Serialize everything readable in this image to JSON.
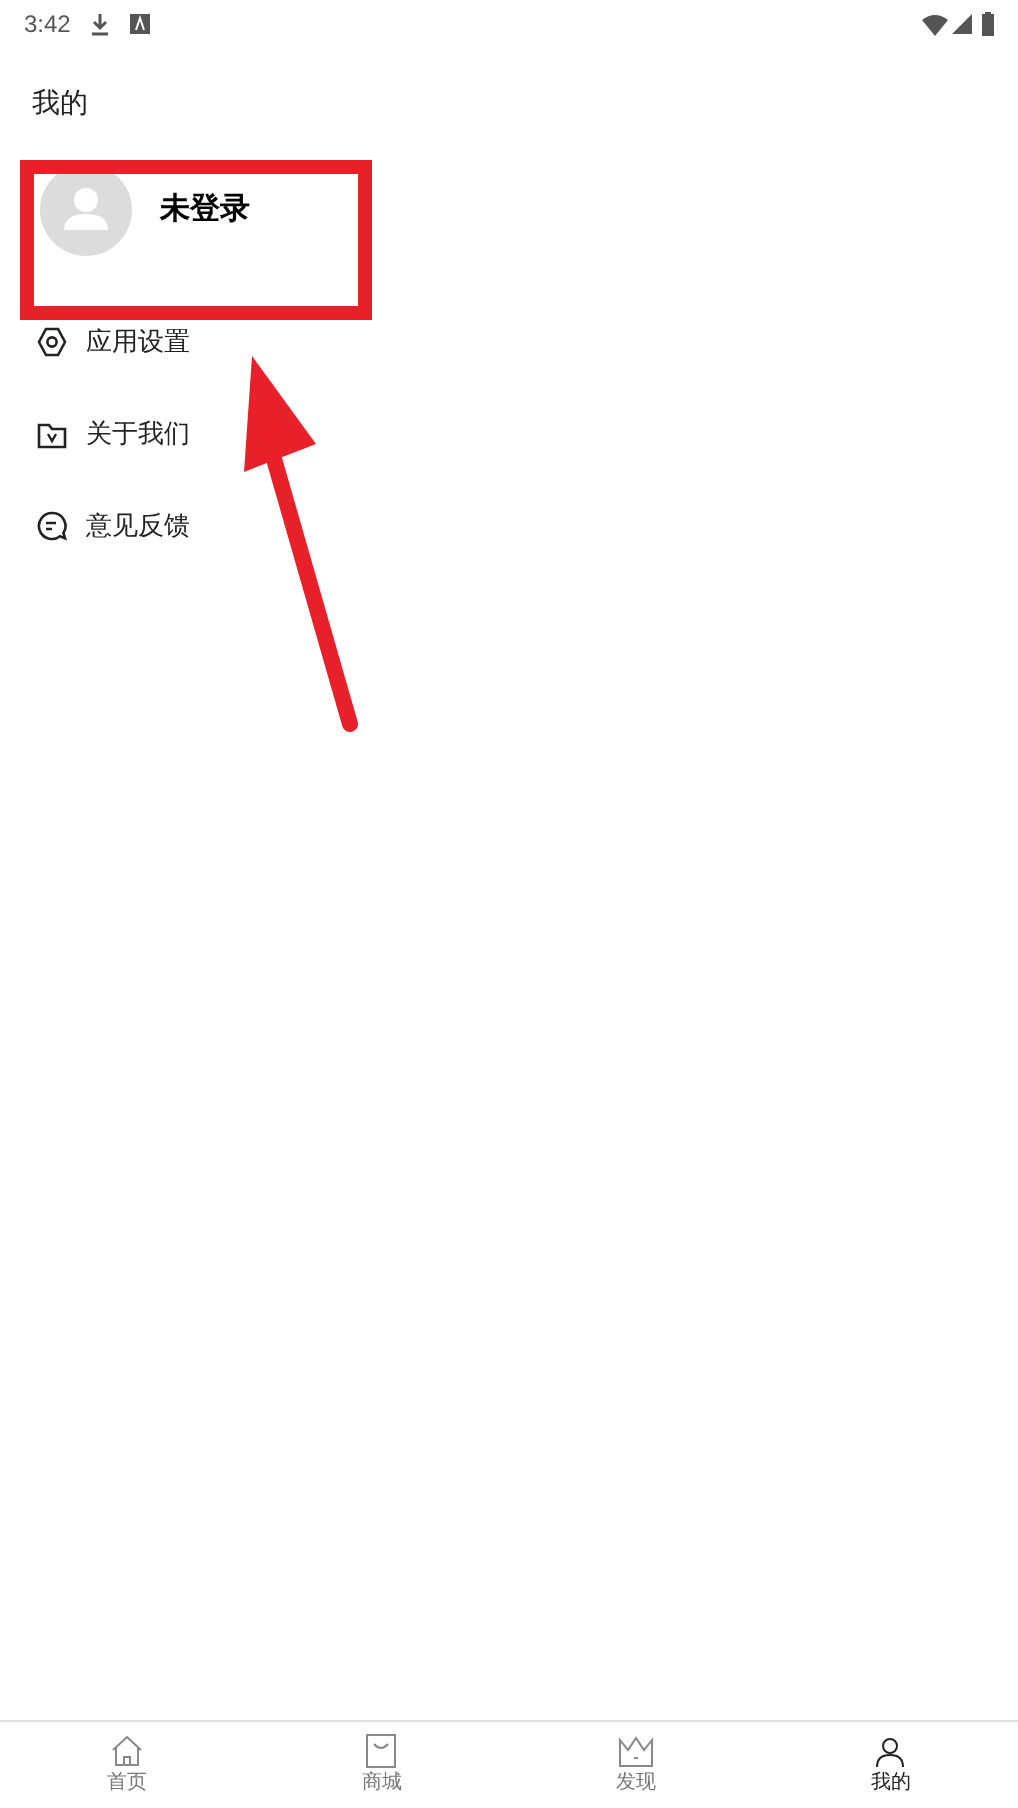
{
  "status_bar": {
    "time": "3:42"
  },
  "page_title": "我的",
  "profile": {
    "name": "未登录"
  },
  "menu": [
    {
      "kind": "settings",
      "label": "应用设置"
    },
    {
      "kind": "about",
      "label": "关于我们"
    },
    {
      "kind": "feedback",
      "label": "意见反馈"
    }
  ],
  "tab_bar": [
    {
      "kind": "home",
      "label": "首页",
      "selected": false
    },
    {
      "kind": "shop",
      "label": "商城",
      "selected": false
    },
    {
      "kind": "discover",
      "label": "发现",
      "selected": false
    },
    {
      "kind": "mine",
      "label": "我的",
      "selected": true
    }
  ]
}
